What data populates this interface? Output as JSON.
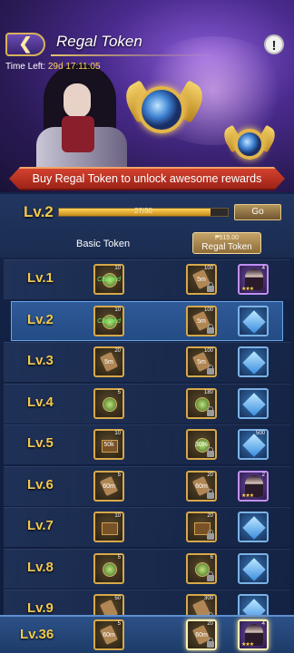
{
  "header": {
    "title": "Regal Token",
    "time_left_label": "Time Left:",
    "time_left_value": "29d 17:11:05",
    "banner_text": "Buy Regal Token to unlock awesome rewards",
    "info_icon": "!"
  },
  "level": {
    "label": "Lv.2",
    "xp_text": "27/30",
    "xp_fraction": 0.9,
    "go_label": "Go"
  },
  "columns": {
    "basic_label": "Basic Token",
    "regal_price": "₱515.00",
    "regal_label": "Regal Token"
  },
  "rows": [
    {
      "lv": "Lv.1",
      "basic": {
        "count": "10",
        "text": "Claimed",
        "claimed": true,
        "kind": "coin"
      },
      "regal1": {
        "count": "100",
        "text": "5m",
        "kind": "scroll",
        "lock": true
      },
      "regal2": {
        "count": "4",
        "kind": "portrait",
        "stars": "★★★",
        "style": "purple"
      }
    },
    {
      "lv": "Lv.2",
      "basic": {
        "count": "10",
        "text": "Claimed",
        "claimed": true,
        "kind": "coin"
      },
      "regal1": {
        "count": "100",
        "text": "5m",
        "kind": "scroll",
        "lock": true
      },
      "regal2": {
        "count": "",
        "kind": "gem",
        "style": "blue"
      }
    },
    {
      "lv": "Lv.3",
      "basic": {
        "count": "20",
        "text": "5m",
        "kind": "scroll"
      },
      "regal1": {
        "count": "100",
        "text": "5m",
        "kind": "scroll",
        "lock": true
      },
      "regal2": {
        "count": "",
        "kind": "gem",
        "style": "blue"
      }
    },
    {
      "lv": "Lv.4",
      "basic": {
        "count": "5",
        "text": "",
        "kind": "coin"
      },
      "regal1": {
        "count": "180",
        "text": "",
        "kind": "coin",
        "lock": true
      },
      "regal2": {
        "count": "",
        "kind": "gem",
        "style": "blue"
      }
    },
    {
      "lv": "Lv.5",
      "basic": {
        "count": "10",
        "text": "50k",
        "kind": "chest"
      },
      "regal1": {
        "count": "",
        "text": "30%",
        "kind": "coin",
        "lock": true
      },
      "regal2": {
        "count": "500",
        "kind": "gem",
        "style": "blue"
      }
    },
    {
      "lv": "Lv.6",
      "basic": {
        "count": "5",
        "text": "60m",
        "kind": "scroll"
      },
      "regal1": {
        "count": "20",
        "text": "60m",
        "kind": "scroll",
        "lock": true
      },
      "regal2": {
        "count": "2",
        "kind": "portrait",
        "stars": "★★★",
        "style": "purple"
      }
    },
    {
      "lv": "Lv.7",
      "basic": {
        "count": "10",
        "text": "",
        "kind": "chest"
      },
      "regal1": {
        "count": "20",
        "text": "",
        "kind": "chest",
        "lock": true
      },
      "regal2": {
        "count": "",
        "kind": "gem",
        "style": "blue"
      }
    },
    {
      "lv": "Lv.8",
      "basic": {
        "count": "5",
        "text": "",
        "kind": "coin"
      },
      "regal1": {
        "count": "6",
        "text": "",
        "kind": "coin",
        "lock": true
      },
      "regal2": {
        "count": "",
        "kind": "gem",
        "style": "blue"
      }
    },
    {
      "lv": "Lv.9",
      "basic": {
        "count": "50",
        "text": "",
        "kind": "scroll"
      },
      "regal1": {
        "count": "300",
        "text": "",
        "kind": "scroll",
        "lock": true
      },
      "regal2": {
        "count": "",
        "kind": "gem",
        "style": "blue"
      }
    }
  ],
  "footer": {
    "lv": "Lv.36",
    "basic": {
      "count": "5",
      "text": "60m",
      "kind": "scroll"
    },
    "regal1": {
      "count": "20",
      "text": "60m",
      "kind": "scroll",
      "lock": true,
      "glow": true
    },
    "regal2": {
      "count": "4",
      "kind": "portrait",
      "stars": "★★★",
      "style": "purple",
      "glow": true
    }
  },
  "colors": {
    "accent_gold": "#f3c84e",
    "ribbon_red": "#c0392b",
    "selected_row": "#2f5a98"
  }
}
